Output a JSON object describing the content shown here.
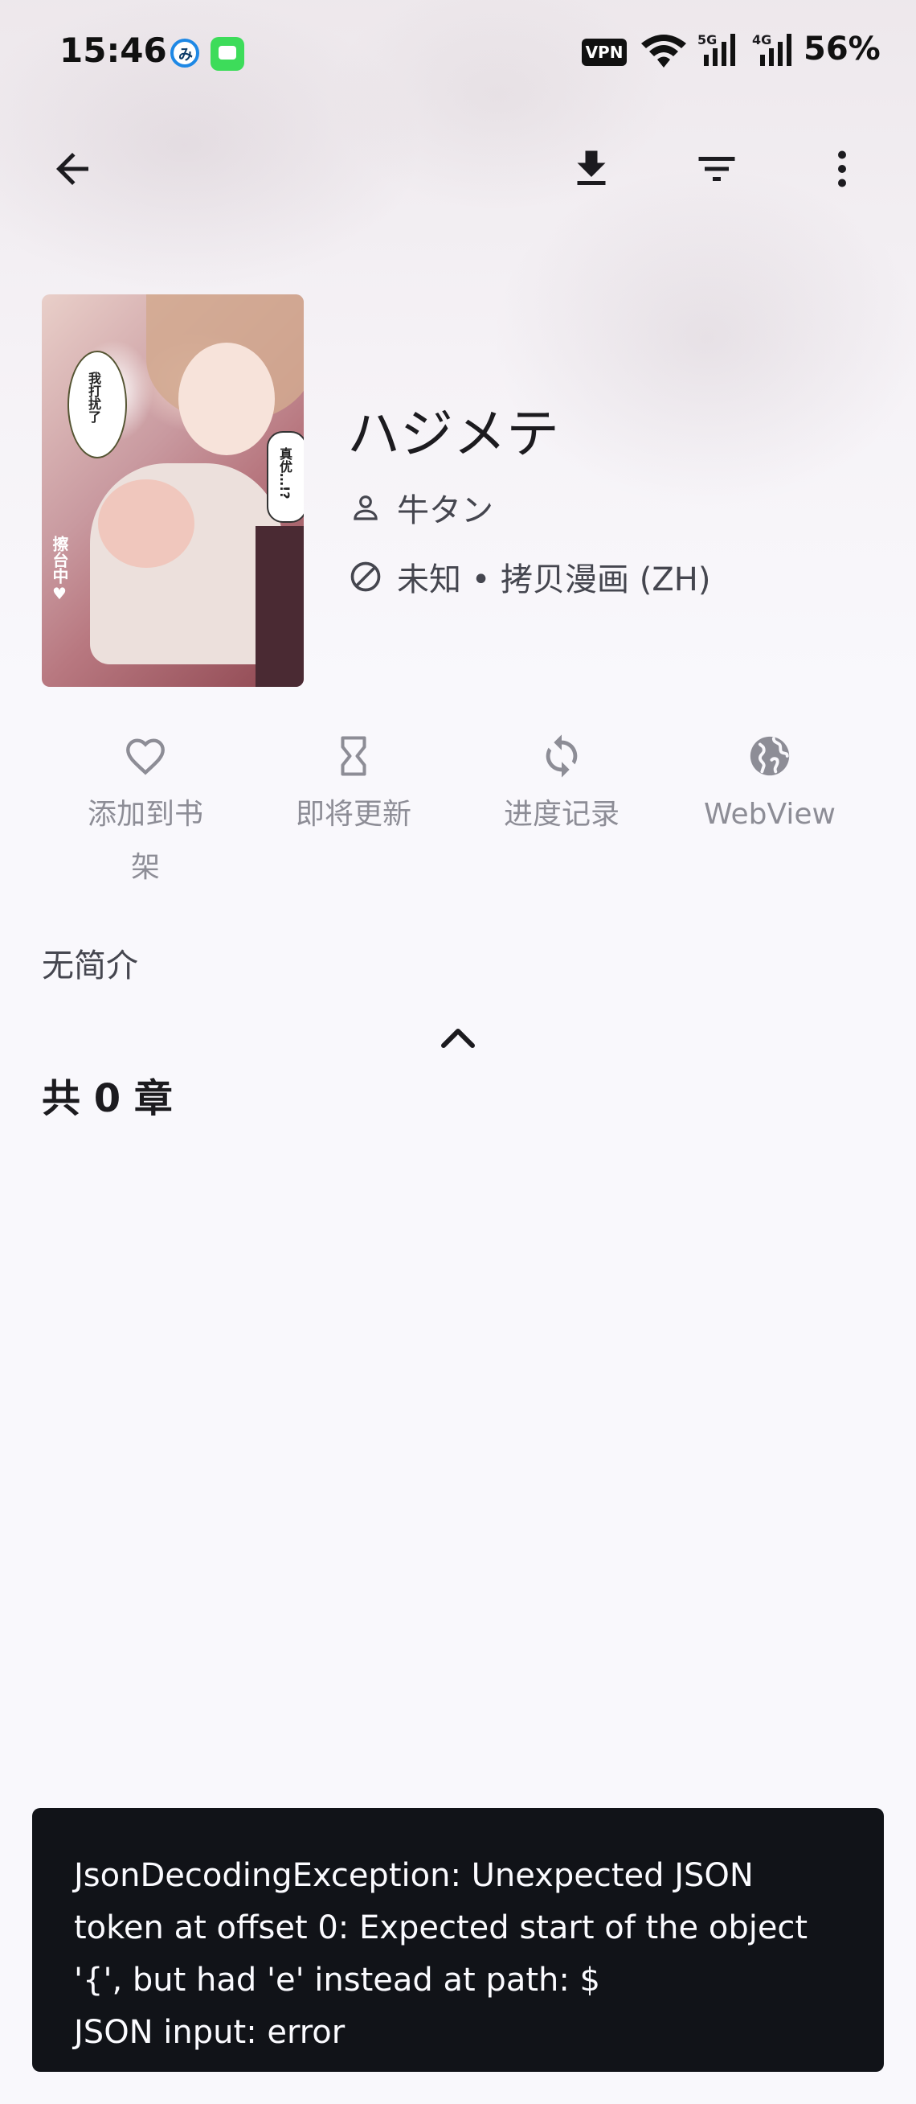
{
  "status_bar": {
    "time": "15:46",
    "vpn": "VPN",
    "signal1_label": "5G",
    "signal2_label": "4G",
    "battery": "56%",
    "icons": [
      "notification-app-icon",
      "messages-icon",
      "vpn-icon",
      "wifi-icon",
      "signal-5g-icon",
      "signal-4g-icon"
    ]
  },
  "toolbar": {
    "icons": [
      "back-arrow-icon",
      "download-icon",
      "filter-icon",
      "more-vert-icon"
    ]
  },
  "manga": {
    "title": "ハジメテ",
    "author": "牛タン",
    "status_source": "未知 • 拷贝漫画 (ZH)",
    "cover_text": [
      "我打扰了",
      "真优…!?",
      "擦台中♥"
    ]
  },
  "actions": [
    {
      "label": "添加到书架",
      "icon": "heart-outline-icon"
    },
    {
      "label": "即将更新",
      "icon": "hourglass-icon"
    },
    {
      "label": "进度记录",
      "icon": "sync-icon"
    },
    {
      "label": "WebView",
      "icon": "globe-icon"
    }
  ],
  "description": "无简介",
  "chapter_count": "共 0 章",
  "snackbar": {
    "lines": [
      "JsonDecodingException: Unexpected JSON",
      "token at offset 0: Expected start of the object",
      "'{', but had 'e' instead at path: $",
      "JSON input: error"
    ]
  },
  "colors": {
    "background": "#f9f8fc",
    "snackbar": "#111318",
    "muted_action": "#8d8d96"
  }
}
